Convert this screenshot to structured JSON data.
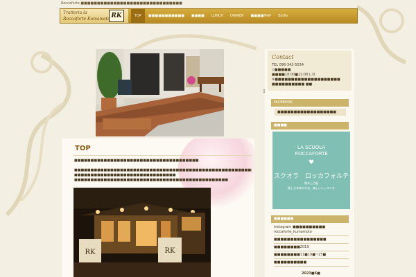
{
  "top_tagline": "Roccaforte ■■■■■■■■■■■■■■■■■■■■■■■■■■■■■■■",
  "logo": {
    "line1": "Trattoria la",
    "line2": "Roccaforte Kumamoto",
    "mark": "RK"
  },
  "nav": [
    {
      "label": "TOP",
      "active": true
    },
    {
      "label": "■■■■■■■■■■■"
    },
    {
      "label": "■■■■"
    },
    {
      "label": "LUNCH"
    },
    {
      "label": "DINNER"
    },
    {
      "label": "■■■■MAP"
    },
    {
      "label": "BLOG"
    }
  ],
  "page_title": "TOP",
  "paragraphs": [
    "■■■■■■■■■■■■■■■■■■■■■■■■■■■■■■■■■■■■■■",
    "■■■■■■■■■■■■■■■■■■■■■■■■■■■■■■■■■■■■■■■■■■■■■■■■■■■■■■■■■■■■■■■■■■■■■■■■■■■■■■■■■■■■■■■",
    "■■■■■■■■■■■■■■■■■■■■■■■■■■■■■■■",
    "■■■■■■■■■■■■■■■■■■■■■■■■■■■■■■■■■■■■■■■■■■■■■■■"
  ],
  "sidebar": {
    "contact_title": "Contact",
    "contact_lines": [
      "TEL 096-342-5534",
      "◇■■■■■",
      "■■■■18:00■22:00 L.O.",
      "※■■■■■■■■■■■■■■■■■■■■",
      "■■■■■■■■■■ ■■"
    ],
    "facebook_head": "FACEBOOK",
    "facebook_link": "■■■■■■■■■■■■■■■■■■",
    "lesson_head": "■■■■",
    "lesson": {
      "line1": "LA SCUOLA",
      "line2": "ROCCAFORTE",
      "heart": "♥",
      "line3": "スクオラ　ロッカフォルテ",
      "line4": "熊本上乃裏",
      "line5": "懐しき未来のため、楽しいレッスンを"
    },
    "recent_head": "■■■■■■",
    "recent": [
      "instagram ■■■■■■■■■■",
      "roccaforte_kumamoto",
      "■■■■■■■■■■■■■■■■",
      "■■■■■■■■2019",
      "■■■■■■■■11■19■~25■",
      "■■■■■■■■■■"
    ],
    "calendar_label": "2023■6■"
  }
}
